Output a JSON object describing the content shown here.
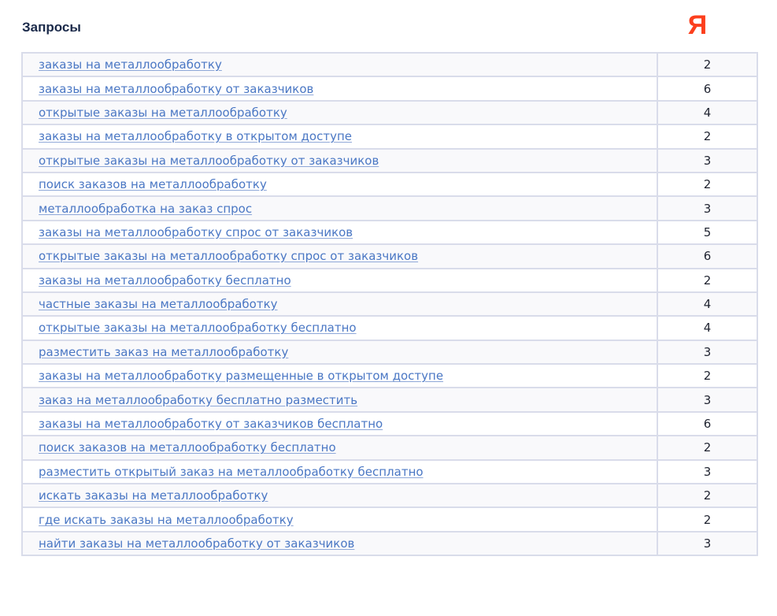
{
  "header": {
    "title": "Запросы",
    "engine_icon": "yandex-icon",
    "engine_letter": "Я",
    "engine_color": "#fc3f1d"
  },
  "colors": {
    "link": "#4a77c4",
    "border": "#d9dcea",
    "title": "#1b2a4a"
  },
  "rows": [
    {
      "query": "заказы на металлообработку",
      "count": "2"
    },
    {
      "query": "заказы на металлообработку от заказчиков",
      "count": "6"
    },
    {
      "query": "открытые заказы на металлообработку",
      "count": "4"
    },
    {
      "query": "заказы на металлообработку в открытом доступе",
      "count": "2"
    },
    {
      "query": "открытые заказы на металлообработку от заказчиков",
      "count": "3"
    },
    {
      "query": "поиск заказов на металлообработку",
      "count": "2"
    },
    {
      "query": "металлообработка на заказ спрос",
      "count": "3"
    },
    {
      "query": "заказы на металлообработку спрос от заказчиков",
      "count": "5"
    },
    {
      "query": "открытые заказы на металлообработку спрос от заказчиков",
      "count": "6"
    },
    {
      "query": "заказы на металлообработку бесплатно",
      "count": "2"
    },
    {
      "query": "частные заказы на металлообработку",
      "count": "4"
    },
    {
      "query": "открытые заказы на металлообработку бесплатно",
      "count": "4"
    },
    {
      "query": "разместить заказ на металлообработку",
      "count": "3"
    },
    {
      "query": "заказы на металлообработку размещенные в открытом доступе",
      "count": "2"
    },
    {
      "query": "заказ на металлообработку бесплатно разместить",
      "count": "3"
    },
    {
      "query": "заказы на металлообработку от заказчиков бесплатно",
      "count": "6"
    },
    {
      "query": "поиск заказов на металлообработку бесплатно",
      "count": "2"
    },
    {
      "query": "разместить открытый заказ на металлообработку бесплатно",
      "count": "3"
    },
    {
      "query": "искать заказы на металлообработку",
      "count": "2"
    },
    {
      "query": "где искать заказы на металлообработку",
      "count": "2"
    },
    {
      "query": "найти заказы на металлообработку от заказчиков",
      "count": "3"
    }
  ]
}
